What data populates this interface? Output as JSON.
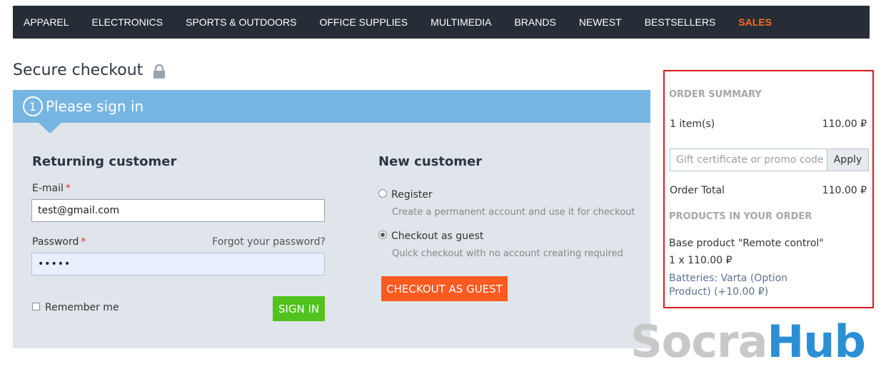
{
  "nav": {
    "items": [
      "APPAREL",
      "ELECTRONICS",
      "SPORTS & OUTDOORS",
      "OFFICE SUPPLIES",
      "MULTIMEDIA",
      "BRANDS",
      "NEWEST",
      "BESTSELLERS"
    ],
    "sales": "SALES"
  },
  "page_title": "Secure checkout",
  "step": {
    "number": "1",
    "title": "Please sign in"
  },
  "returning": {
    "title": "Returning customer",
    "email_label": "E-mail",
    "email_value": "test@gmail.com",
    "required_mark": "*",
    "password_label": "Password",
    "password_value": "•••••",
    "forgot_link": "Forgot your password?",
    "remember_label": "Remember me",
    "sign_in_button": "SIGN IN"
  },
  "new_customer": {
    "title": "New customer",
    "register_label": "Register",
    "register_hint": "Create a permanent account and use it for checkout",
    "guest_label": "Checkout as guest",
    "guest_hint": "Quick checkout with no account creating required",
    "guest_button": "CHECKOUT AS GUEST"
  },
  "summary": {
    "heading": "ORDER SUMMARY",
    "items_label": "1 item(s)",
    "items_total": "110.00 ₽",
    "promo_placeholder": "Gift certificate or promo code",
    "apply_button": "Apply",
    "order_total_label": "Order Total",
    "order_total_value": "110.00 ₽",
    "products_heading": "PRODUCTS IN YOUR ORDER",
    "product_name": "Base product \"Remote control\"",
    "product_qty": "1 x 110.00 ₽",
    "product_option": "Batteries: Varta (Option Product) (+10.00 ₽)"
  },
  "watermark": {
    "part1": "Socra",
    "part2": "Hub"
  },
  "colors": {
    "nav_bg": "#262d36",
    "sales": "#ff6a21",
    "step_header": "#77b6e2",
    "panel_bg": "#dfe5eb",
    "sign_in": "#51c21e",
    "guest_button": "#ff5a1f",
    "highlight_border": "#e0171c"
  },
  "icons": {
    "lock": "lock-icon"
  }
}
